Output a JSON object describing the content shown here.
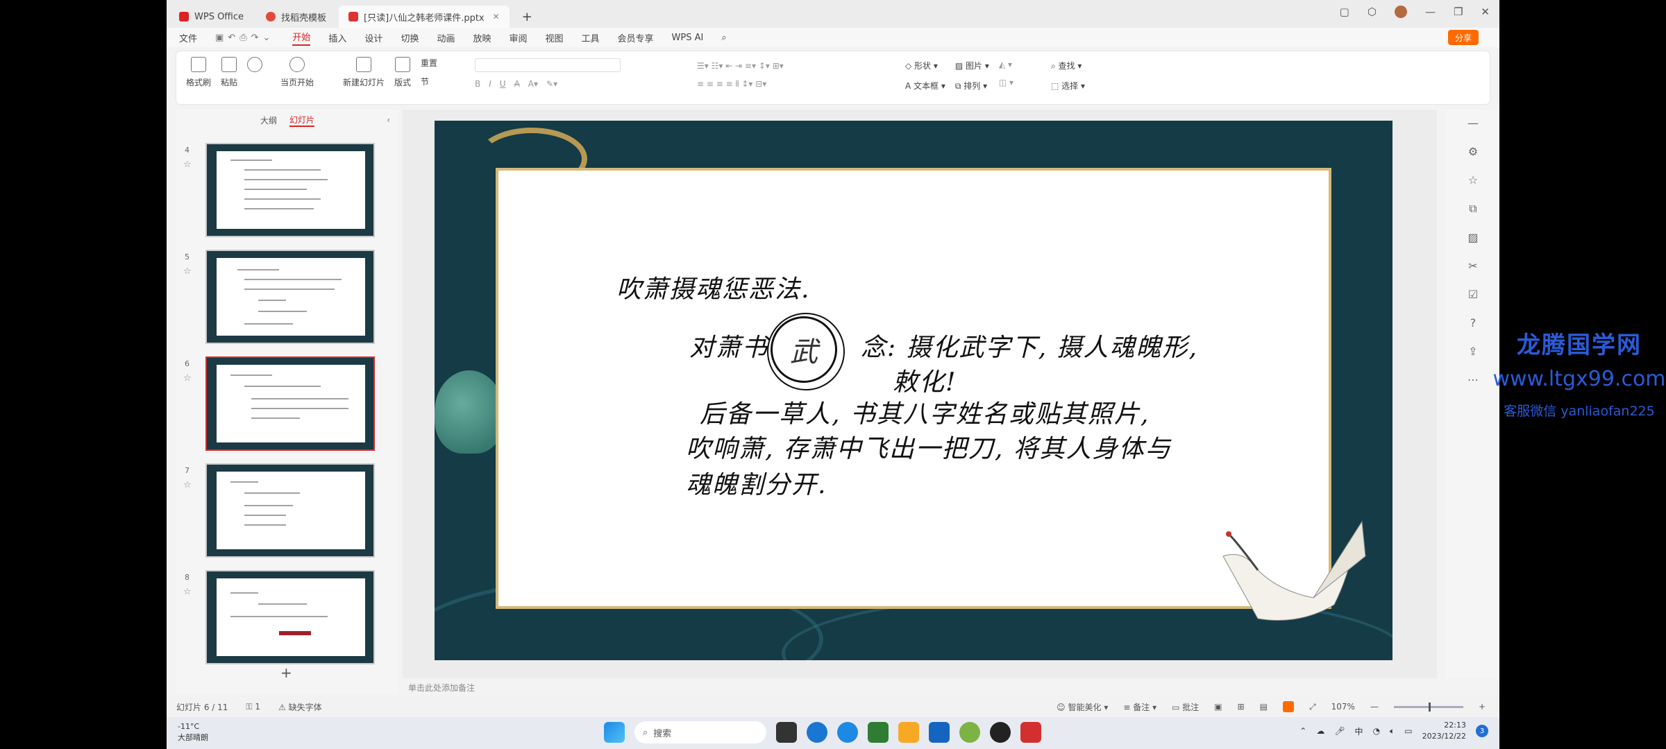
{
  "titlebar": {
    "tabs": [
      {
        "label": "WPS Office"
      },
      {
        "label": "找稻壳模板"
      },
      {
        "label": "[只读]八仙之韩老师课件.pptx"
      }
    ]
  },
  "menu": {
    "items": [
      "文件",
      "开始",
      "插入",
      "设计",
      "切换",
      "动画",
      "放映",
      "审阅",
      "视图",
      "工具",
      "会员专享",
      "WPS AI"
    ],
    "active": "开始",
    "share": "分享"
  },
  "ribbon": {
    "format_painter": "格式刷",
    "paste": "粘贴",
    "from_start": "当页开始",
    "new_slide": "新建幻灯片",
    "layout": "版式",
    "reset": "重置",
    "section": "节",
    "shape": "形状",
    "picture": "图片",
    "textbox": "文本框",
    "arrange": "排列",
    "find": "查找",
    "select": "选择"
  },
  "left_panel": {
    "tab_outline": "大纲",
    "tab_slides": "幻灯片",
    "thumbnails": [
      {
        "num": "4"
      },
      {
        "num": "5"
      },
      {
        "num": "6"
      },
      {
        "num": "7"
      },
      {
        "num": "8"
      }
    ],
    "selected": 6
  },
  "slide": {
    "line1": "吹萧摄魂惩恶法.",
    "line2a": "对萧书",
    "seal": "武",
    "line2b": "念: 摄化武字下, 摄人魂魄形,",
    "line3": "敕化!",
    "line4": "后备一草人, 书其八字姓名或贴其照片,",
    "line5": "吹响萧, 存萧中飞出一把刀, 将其人身体与",
    "line6": "魂魄割分开."
  },
  "notes": {
    "placeholder": "单击此处添加备注"
  },
  "status": {
    "slide_count": "幻灯片 6 / 11",
    "comments": "1",
    "missing_font": "缺失字体",
    "beautify": "智能美化",
    "notes": "备注",
    "annot": "批注",
    "zoom": "107%"
  },
  "taskbar": {
    "weather_temp": "-11°C",
    "weather_text": "大部晴朗",
    "search": "搜索",
    "ime": "中",
    "time": "22:13",
    "date": "2023/12/22",
    "notif": "3"
  },
  "watermark": {
    "line1": "龙腾国学网",
    "line2": "www.ltgx99.com",
    "line3": "客服微信 yanliaofan225"
  },
  "colors": {
    "accent": "#d22222",
    "share": "#ff6a00",
    "slide_bg": "#143b46",
    "paper_border": "#d6b97a"
  }
}
